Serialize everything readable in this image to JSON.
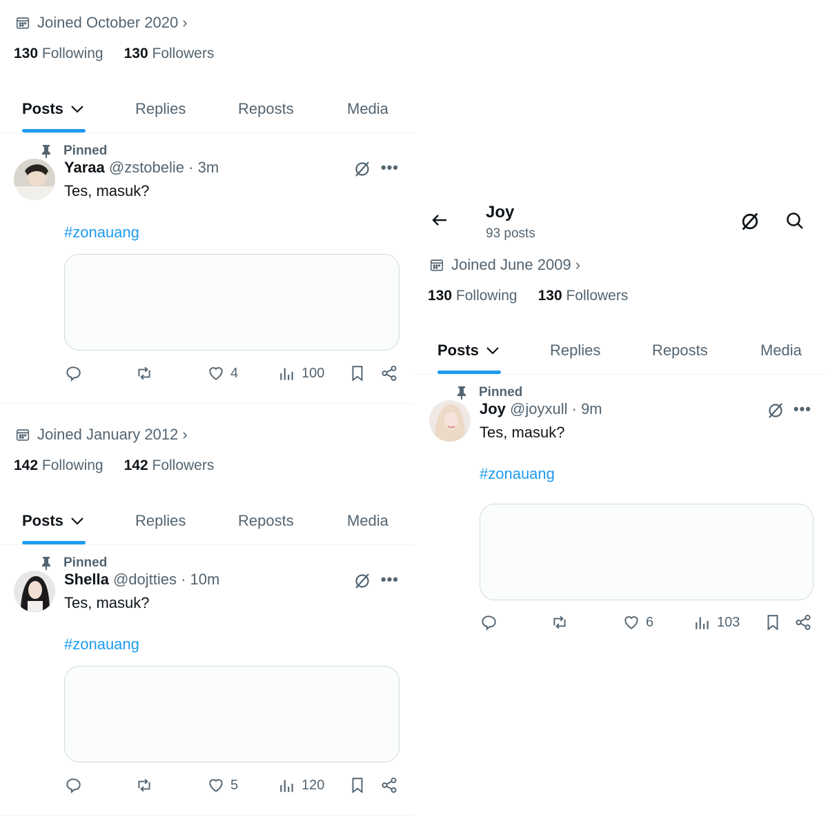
{
  "colors": {
    "accent": "#1d9bf0",
    "muted": "#536471",
    "text": "#0f1419",
    "border": "#cfd9de"
  },
  "profiles": [
    {
      "joined": "Joined October 2020",
      "following_count": "130",
      "following_label": "Following",
      "followers_count": "130",
      "followers_label": "Followers",
      "tabs": [
        "Posts",
        "Replies",
        "Reposts",
        "Media"
      ],
      "post": {
        "pinned_label": "Pinned",
        "name": "Yaraa",
        "handle": "@zstobelie",
        "time": " · 3m",
        "text": "Tes, masuk?",
        "hashtag": "#zonauang",
        "likes": "4",
        "views": "100"
      }
    },
    {
      "joined": "Joined January 2012",
      "following_count": "142",
      "following_label": "Following",
      "followers_count": "142",
      "followers_label": "Followers",
      "tabs": [
        "Posts",
        "Replies",
        "Reposts",
        "Media"
      ],
      "post": {
        "pinned_label": "Pinned",
        "name": "Shella",
        "handle": "@dojtties",
        "time": " · 10m",
        "text": "Tes, masuk?",
        "hashtag": "#zonauang",
        "likes": "5",
        "views": "120"
      }
    },
    {
      "header_name": "Joy",
      "header_count": "93 posts",
      "joined": "Joined June 2009",
      "following_count": "130",
      "following_label": "Following",
      "followers_count": "130",
      "followers_label": "Followers",
      "tabs": [
        "Posts",
        "Replies",
        "Reposts",
        "Media"
      ],
      "post": {
        "pinned_label": "Pinned",
        "name": "Joy",
        "handle": "@joyxull",
        "time": " · 9m",
        "text": "Tes, masuk?",
        "hashtag": "#zonauang",
        "likes": "6",
        "views": "103"
      }
    }
  ],
  "icons": [
    "calendar-icon",
    "chevron-right-icon",
    "chevron-down-icon",
    "pin-icon",
    "grok-icon",
    "more-icon",
    "reply-icon",
    "repost-icon",
    "like-icon",
    "views-icon",
    "bookmark-icon",
    "share-icon",
    "back-arrow-icon",
    "search-icon"
  ]
}
